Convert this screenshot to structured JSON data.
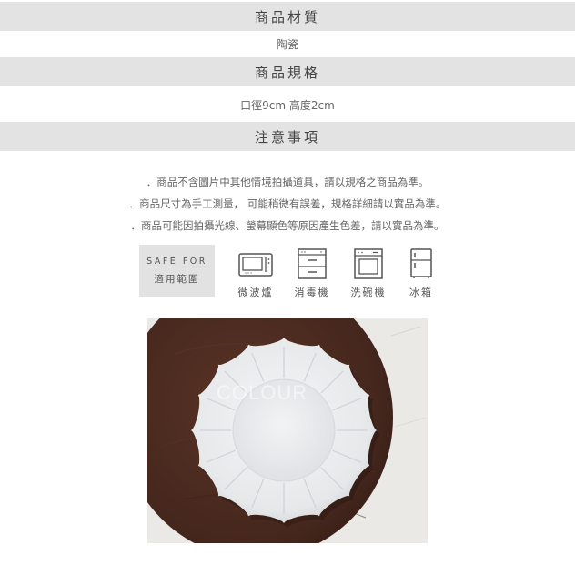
{
  "sections": {
    "material_title": "商品材質",
    "material_value": "陶瓷",
    "spec_title": "商品規格",
    "spec_value": "口徑9cm 高度2cm",
    "notice_title": "注意事項"
  },
  "notices": [
    "．商品不含圖片中其他情境拍攝道具，請以規格之商品為準。",
    "．商品尺寸為手工測量， 可能稍微有誤差，規格詳細請以實品為準。",
    "．商品可能因拍攝光線、螢幕顯色等原因產生色差，請以實品為準。"
  ],
  "safe_for": {
    "en": "SAFE FOR",
    "zh": "適用範圍"
  },
  "appliances": [
    {
      "label": "微波爐",
      "icon": "microwave-icon"
    },
    {
      "label": "消毒機",
      "icon": "sterilizer-icon"
    },
    {
      "label": "洗碗機",
      "icon": "dishwasher-icon"
    },
    {
      "label": "冰箱",
      "icon": "refrigerator-icon"
    }
  ],
  "photo": {
    "watermark": "COLOUR"
  },
  "colors": {
    "band": "#e3e3e3",
    "table_wood": "#4a2a1f",
    "plate": "#eef0f1"
  }
}
